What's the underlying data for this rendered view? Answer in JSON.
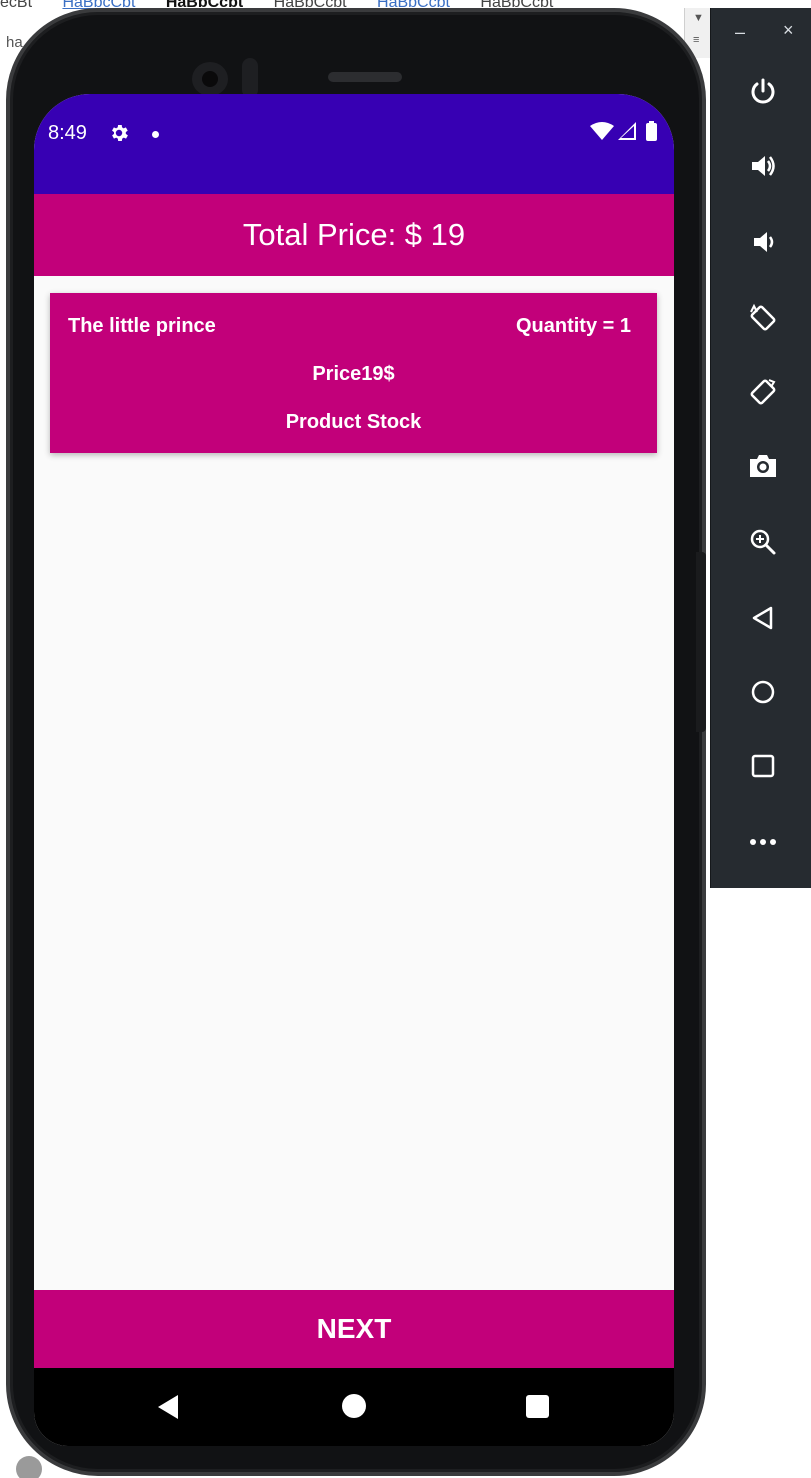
{
  "background_window": {
    "tabs": [
      "ecBt",
      "HaBbcCbt",
      "HaBbCcbt",
      "HaBbCcbt",
      "HaBbCcbt",
      "HaBbCcbt"
    ],
    "fragment": "ha"
  },
  "status_bar": {
    "time": "8:49",
    "icons": [
      "gear-icon",
      "notification-dot-icon",
      "wifi-icon",
      "cell-signal-icon",
      "battery-icon"
    ]
  },
  "app": {
    "header_title": "Total Price: $ 19",
    "cart_items": [
      {
        "name": "The little prince",
        "quantity": "Quantity = 1",
        "price": "Price19$",
        "stock": "Product Stock"
      }
    ],
    "next_label": "NEXT"
  },
  "nav_bar": {
    "icons": [
      "back-icon",
      "home-icon",
      "recents-icon"
    ]
  },
  "emulator_toolbar": {
    "minimize": "–",
    "close": "×",
    "buttons": [
      "power-icon",
      "volume-up-icon",
      "volume-down-icon",
      "rotate-left-icon",
      "rotate-right-icon",
      "camera-icon",
      "zoom-icon",
      "back-icon",
      "home-icon",
      "overview-icon",
      "more-icon"
    ]
  },
  "colors": {
    "status_bar": "#3700b3",
    "accent": "#c2007a",
    "screen_bg": "#fafafa",
    "toolbar_bg": "#262b30"
  }
}
